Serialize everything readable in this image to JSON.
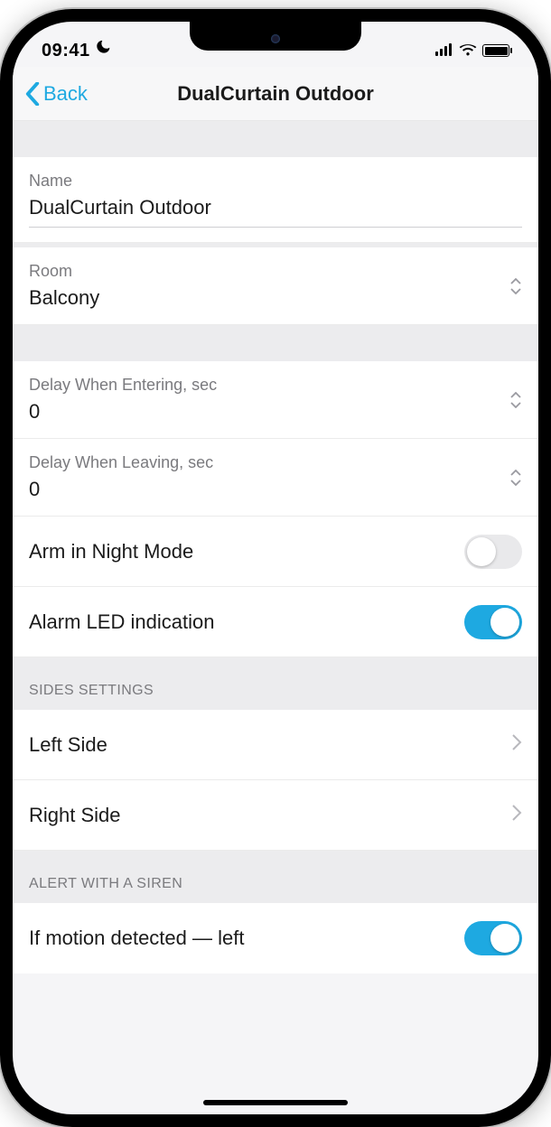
{
  "statusBar": {
    "time": "09:41"
  },
  "nav": {
    "back": "Back",
    "title": "DualCurtain Outdoor"
  },
  "name": {
    "label": "Name",
    "value": "DualCurtain Outdoor"
  },
  "room": {
    "label": "Room",
    "value": "Balcony"
  },
  "delayEntering": {
    "label": "Delay When Entering, sec",
    "value": "0"
  },
  "delayLeaving": {
    "label": "Delay When Leaving, sec",
    "value": "0"
  },
  "nightMode": {
    "label": "Arm in Night Mode",
    "on": false
  },
  "ledIndication": {
    "label": "Alarm LED indication",
    "on": true
  },
  "sidesHeader": "SIDES SETTINGS",
  "leftSide": {
    "label": "Left Side"
  },
  "rightSide": {
    "label": "Right Side"
  },
  "alertHeader": "ALERT WITH A SIREN",
  "motionLeft": {
    "label": "If motion detected — left",
    "on": true
  }
}
